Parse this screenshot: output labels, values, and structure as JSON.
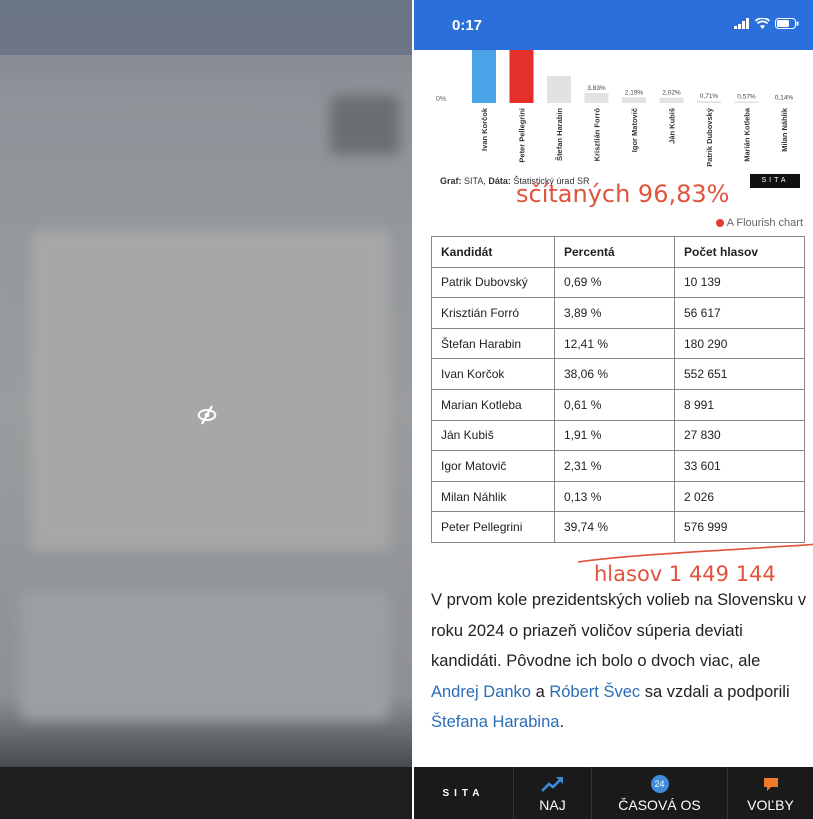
{
  "status_bar": {
    "time": "0:17"
  },
  "chart_data": {
    "type": "bar",
    "categories": [
      "Ivan Korčok",
      "Peter Pellegrini",
      "Štefan Harabin",
      "Krisztián Forró",
      "Igor Matovič",
      "Ján Kubiš",
      "Patrik Dubovský",
      "Marián Kotleba",
      "Milan Náhlik"
    ],
    "values": [
      42.4,
      37.1,
      10.4,
      3.83,
      2.19,
      2.02,
      0.71,
      0.57,
      0.14
    ],
    "value_labels": [
      "",
      "",
      "",
      "3,83%",
      "2,19%",
      "2,02%",
      "0,71%",
      "0,57%",
      "0,14%"
    ],
    "colors": [
      "#4aa3e6",
      "#e4302a",
      "#e2e2e2",
      "#e2e2e2",
      "#e2e2e2",
      "#e2e2e2",
      "#e2e2e2",
      "#e2e2e2",
      "#e2e2e2"
    ],
    "y_tick": "0%",
    "ylim": [
      0,
      100
    ]
  },
  "chart_source": {
    "prefix": "Graf:",
    "graph": "SITA,",
    "data_prefix": "Dáta:",
    "data": "Štatistický úrad SR"
  },
  "sita_logo": "SITA",
  "annotations": {
    "counted": "sčítaných 96,83%",
    "votes": "hlasov 1 449 144"
  },
  "flourish_credit": "A Flourish chart",
  "table": {
    "headers": [
      "Kandidát",
      "Percentá",
      "Počet hlasov"
    ],
    "rows": [
      [
        "Patrik Dubovský",
        "0,69 %",
        "10 139"
      ],
      [
        "Krisztián Forró",
        "3,89 %",
        "56 617"
      ],
      [
        "Štefan Harabin",
        "12,41 %",
        "180 290"
      ],
      [
        "Ivan Korčok",
        "38,06 %",
        "552 651"
      ],
      [
        "Marian Kotleba",
        "0,61 %",
        "8 991"
      ],
      [
        "Ján Kubiš",
        "1,91 %",
        "27 830"
      ],
      [
        "Igor Matovič",
        "2,31 %",
        "33 601"
      ],
      [
        "Milan Náhlik",
        "0,13 %",
        "2 026"
      ],
      [
        "Peter Pellegrini",
        "39,74 %",
        "576 999"
      ]
    ]
  },
  "paragraph": {
    "part1": "V prvom kole prezidentských volieb na Slovensku v roku 2024 o priazeň voličov súperia deviati kandidáti. Pôvodne ich bolo o dvoch viac, ale ",
    "link1": "Andrej Danko",
    "part2": " a ",
    "link2": "Róbert Švec",
    "part3": " sa vzdali a podporili ",
    "link3": "Štefana Harabina",
    "part4": "."
  },
  "bottom_nav": {
    "logo": "SITA",
    "items": [
      {
        "label": "NAJ",
        "icon": "trending-up-icon"
      },
      {
        "label": "ČASOVÁ OS",
        "icon": "timeline-badge-icon",
        "badge": "24"
      },
      {
        "label": "VOĽBY",
        "icon": "speech-bubble-icon"
      }
    ]
  },
  "colors": {
    "status_bar": "#2a6fdb",
    "annotation": "#e0533c",
    "link": "#2b6cb8",
    "nav_bg": "#1a1a1a",
    "badge": "#3d8bd9",
    "voting_icon": "#f07a2a",
    "trend_icon": "#3d8bd9"
  }
}
